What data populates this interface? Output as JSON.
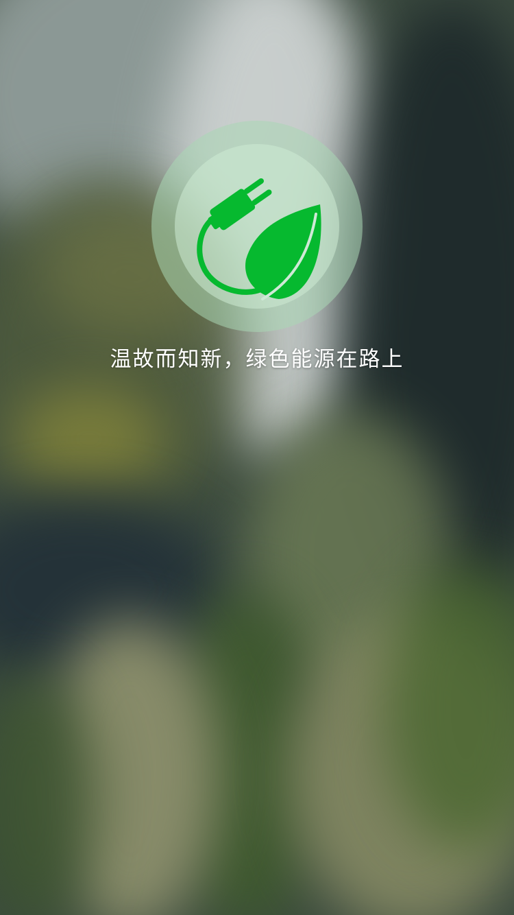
{
  "splash": {
    "logo_icon": "plug-leaf-icon",
    "logo_color": "#06b92f",
    "slogan": "温故而知新，绿色能源在路上"
  }
}
